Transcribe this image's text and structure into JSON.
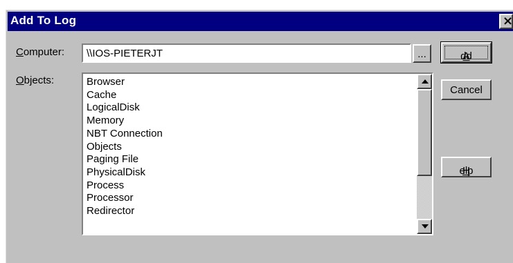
{
  "window": {
    "title": "Add To Log",
    "close_glyph": "×"
  },
  "computer": {
    "label_mnemonic": "C",
    "label_rest": "omputer:",
    "value": "\\\\IOS-PIETERJT",
    "browse_label": "..."
  },
  "objects": {
    "label_mnemonic": "O",
    "label_rest": "bjects:",
    "items": [
      "Browser",
      "Cache",
      "LogicalDisk",
      "Memory",
      "NBT Connection",
      "Objects",
      "Paging File",
      "PhysicalDisk",
      "Process",
      "Processor",
      "Redirector"
    ]
  },
  "buttons": {
    "add_mnemonic": "A",
    "add_rest": "dd",
    "cancel": "Cancel",
    "help_mnemonic": "H",
    "help_rest": "elp"
  },
  "colors": {
    "titlebar": "#000080",
    "face": "#c0c0c0"
  },
  "icons": {
    "close": "close-icon",
    "scroll_up": "scroll-up-arrow-icon",
    "scroll_down": "scroll-down-arrow-icon"
  }
}
